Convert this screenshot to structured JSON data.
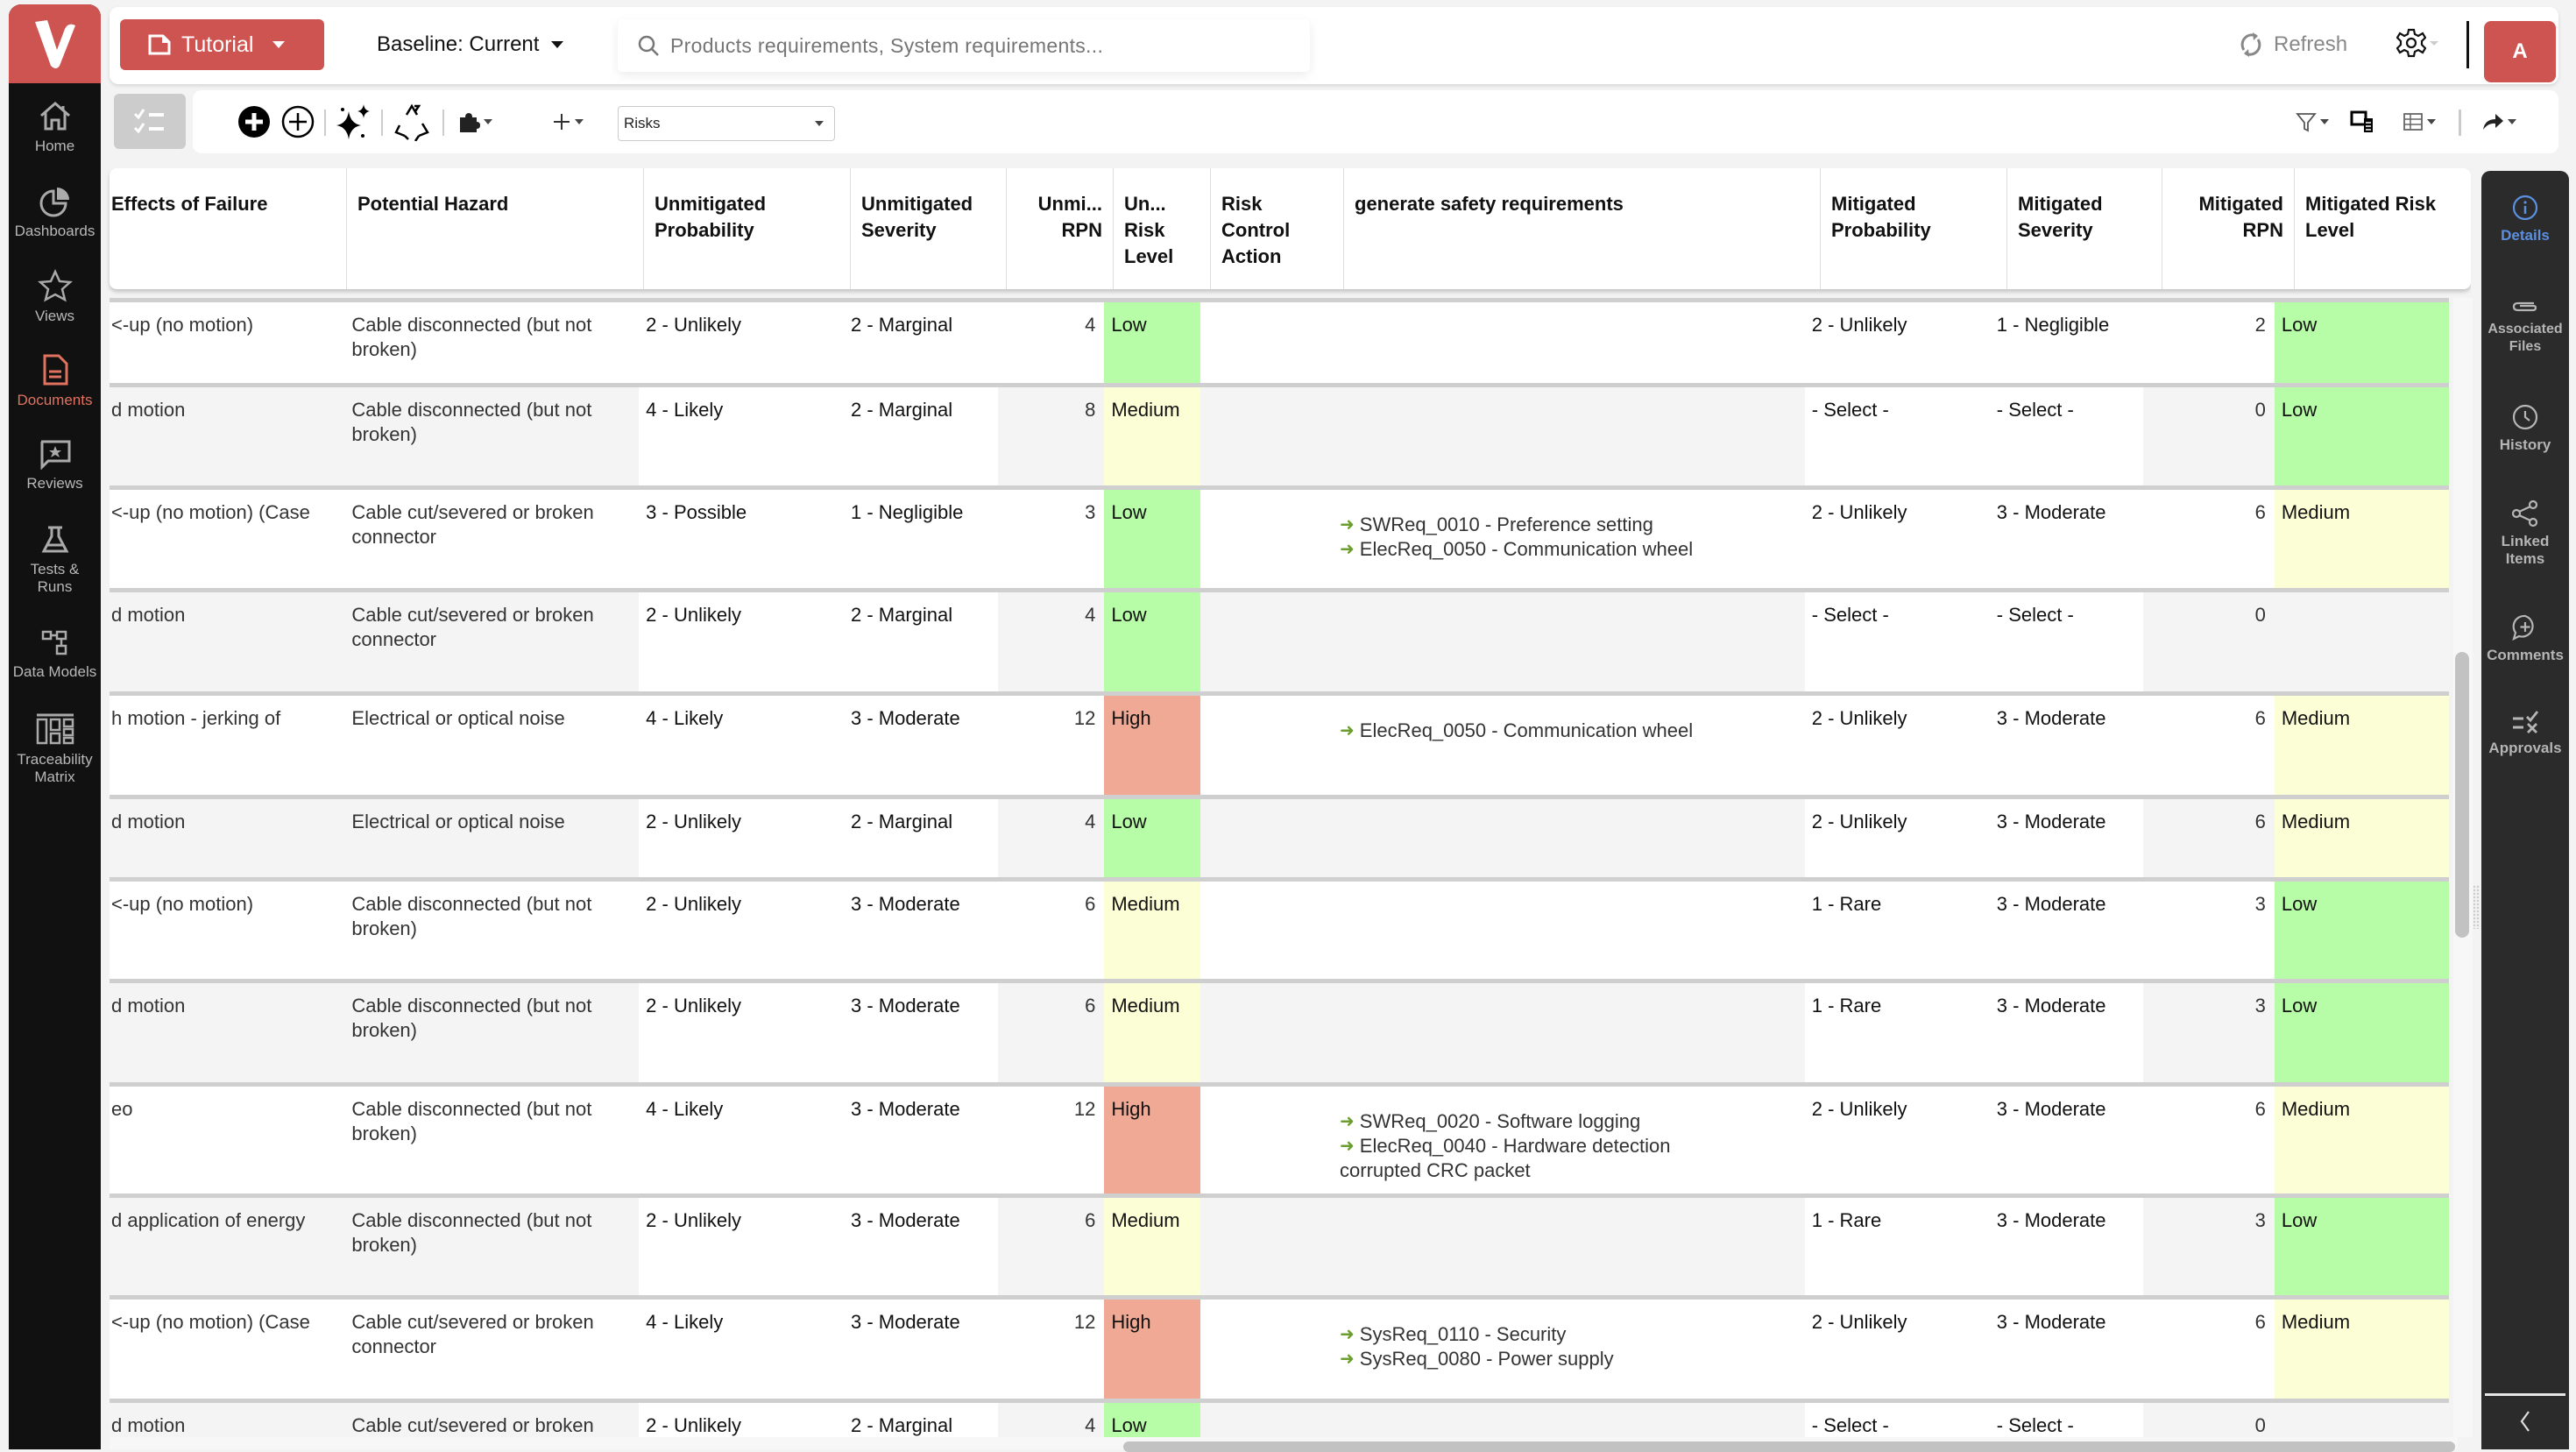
{
  "app": {
    "logo_letter": "V"
  },
  "leftnav": {
    "items": [
      {
        "label": "Home",
        "icon": "home-icon"
      },
      {
        "label": "Dashboards",
        "icon": "pie-chart-icon"
      },
      {
        "label": "Views",
        "icon": "star-icon"
      },
      {
        "label": "Documents",
        "icon": "document-icon",
        "active": true
      },
      {
        "label": "Reviews",
        "icon": "review-icon"
      },
      {
        "label": "Tests & Runs",
        "icon": "flask-icon"
      },
      {
        "label": "Data Models",
        "icon": "data-model-icon"
      },
      {
        "label": "Traceability Matrix",
        "icon": "matrix-icon"
      }
    ]
  },
  "topbar": {
    "project_label": "Tutorial",
    "baseline_label": "Baseline: Current",
    "search_placeholder": "Products requirements, System requirements...",
    "refresh_label": "Refresh",
    "avatar_initial": "A"
  },
  "toolbar": {
    "item_type_select": "Risks"
  },
  "table": {
    "columns": [
      "Effects of Failure",
      "Potential Hazard",
      "Unmitigated Probability",
      "Unmitigated Severity",
      "Unmi... RPN",
      "Un... Risk Level",
      "Risk Control Action",
      "generate safety requirements",
      "Mitigated Probability",
      "Mitigated Severity",
      "Mitigated RPN",
      "Mitigated Risk Level"
    ],
    "rows": [
      {
        "effects": "<-up (no motion)",
        "hazard": "Cable disconnected (but not broken)",
        "u_prob": "2 - Unlikely",
        "u_sev": "2 - Marginal",
        "u_rpn": "4",
        "u_level": "Low",
        "rca": "",
        "reqs": [],
        "reqs_cont": "",
        "m_prob": "2 - Unlikely",
        "m_sev": "1 - Negligible",
        "m_rpn": "2",
        "m_level": "Low"
      },
      {
        "effects": "d motion",
        "hazard": "Cable disconnected (but not broken)",
        "u_prob": "4 - Likely",
        "u_sev": "2 - Marginal",
        "u_rpn": "8",
        "u_level": "Medium",
        "rca": "",
        "reqs": [],
        "reqs_cont": "",
        "m_prob": "- Select -",
        "m_sev": "- Select -",
        "m_rpn": "0",
        "m_level": "Low"
      },
      {
        "effects": "<-up (no motion) (Case",
        "hazard": "Cable cut/severed or broken connector",
        "u_prob": "3 - Possible",
        "u_sev": "1 - Negligible",
        "u_rpn": "3",
        "u_level": "Low",
        "rca": "",
        "reqs": [
          "SWReq_0010 - Preference setting",
          "ElecReq_0050 - Communication wheel"
        ],
        "reqs_cont": "",
        "m_prob": "2 - Unlikely",
        "m_sev": "3 - Moderate",
        "m_rpn": "6",
        "m_level": "Medium"
      },
      {
        "effects": "d motion",
        "hazard": "Cable cut/severed or broken connector",
        "u_prob": "2 - Unlikely",
        "u_sev": "2 - Marginal",
        "u_rpn": "4",
        "u_level": "Low",
        "rca": "",
        "reqs": [],
        "reqs_cont": "",
        "m_prob": "- Select -",
        "m_sev": "- Select -",
        "m_rpn": "0",
        "m_level": ""
      },
      {
        "effects": "h motion - jerking of",
        "hazard": "Electrical or optical noise",
        "u_prob": "4 - Likely",
        "u_sev": "3 - Moderate",
        "u_rpn": "12",
        "u_level": "High",
        "rca": "",
        "reqs": [
          "ElecReq_0050 - Communication wheel"
        ],
        "reqs_cont": "",
        "m_prob": "2 - Unlikely",
        "m_sev": "3 - Moderate",
        "m_rpn": "6",
        "m_level": "Medium"
      },
      {
        "effects": "d motion",
        "hazard": "Electrical or optical noise",
        "u_prob": "2 - Unlikely",
        "u_sev": "2 - Marginal",
        "u_rpn": "4",
        "u_level": "Low",
        "rca": "",
        "reqs": [],
        "reqs_cont": "",
        "m_prob": "2 - Unlikely",
        "m_sev": "3 - Moderate",
        "m_rpn": "6",
        "m_level": "Medium"
      },
      {
        "effects": "<-up (no motion)",
        "hazard": "Cable disconnected (but not broken)",
        "u_prob": "2 - Unlikely",
        "u_sev": "3 - Moderate",
        "u_rpn": "6",
        "u_level": "Medium",
        "rca": "",
        "reqs": [],
        "reqs_cont": "",
        "m_prob": "1 - Rare",
        "m_sev": "3 - Moderate",
        "m_rpn": "3",
        "m_level": "Low"
      },
      {
        "effects": "d motion",
        "hazard": "Cable disconnected (but not broken)",
        "u_prob": "2 - Unlikely",
        "u_sev": "3 - Moderate",
        "u_rpn": "6",
        "u_level": "Medium",
        "rca": "",
        "reqs": [],
        "reqs_cont": "",
        "m_prob": "1 - Rare",
        "m_sev": "3 - Moderate",
        "m_rpn": "3",
        "m_level": "Low"
      },
      {
        "effects": "eo",
        "hazard": "Cable disconnected (but not broken)",
        "u_prob": "4 - Likely",
        "u_sev": "3 - Moderate",
        "u_rpn": "12",
        "u_level": "High",
        "rca": "",
        "reqs": [
          "SWReq_0020 - Software logging",
          "ElecReq_0040 - Hardware detection"
        ],
        "reqs_cont": "corrupted CRC packet",
        "m_prob": "2 - Unlikely",
        "m_sev": "3 - Moderate",
        "m_rpn": "6",
        "m_level": "Medium"
      },
      {
        "effects": "d application of energy",
        "hazard": "Cable disconnected (but not broken)",
        "u_prob": "2 - Unlikely",
        "u_sev": "3 - Moderate",
        "u_rpn": "6",
        "u_level": "Medium",
        "rca": "",
        "reqs": [],
        "reqs_cont": "",
        "m_prob": "1 - Rare",
        "m_sev": "3 - Moderate",
        "m_rpn": "3",
        "m_level": "Low"
      },
      {
        "effects": "<-up (no motion) (Case",
        "hazard": "Cable cut/severed or broken connector",
        "u_prob": "4 - Likely",
        "u_sev": "3 - Moderate",
        "u_rpn": "12",
        "u_level": "High",
        "rca": "",
        "reqs": [
          "SysReq_0110 - Security",
          "SysReq_0080 - Power supply"
        ],
        "reqs_cont": "",
        "m_prob": "2 - Unlikely",
        "m_sev": "3 - Moderate",
        "m_rpn": "6",
        "m_level": "Medium"
      },
      {
        "effects": "d motion",
        "hazard": "Cable cut/severed or broken",
        "u_prob": "2 - Unlikely",
        "u_sev": "2 - Marginal",
        "u_rpn": "4",
        "u_level": "Low",
        "rca": "",
        "reqs": [],
        "reqs_cont": "",
        "m_prob": "- Select -",
        "m_sev": "- Select -",
        "m_rpn": "0",
        "m_level": ""
      }
    ]
  },
  "rightpanel": {
    "items": [
      {
        "label": "Details",
        "icon": "info-icon",
        "active": true
      },
      {
        "label": "Associated Files",
        "icon": "paperclip-icon"
      },
      {
        "label": "History",
        "icon": "clock-icon"
      },
      {
        "label": "Linked Items",
        "icon": "share-icon"
      },
      {
        "label": "Comments",
        "icon": "comment-plus-icon"
      },
      {
        "label": "Approvals",
        "icon": "approvals-icon"
      }
    ]
  },
  "colors": {
    "brand": "#cd5450",
    "risk_low": "#b7fca7",
    "risk_medium": "#fcfed5",
    "risk_high": "#f0a995",
    "active_detail": "#5b8fe0",
    "link_arrow": "#6b9e2e"
  }
}
